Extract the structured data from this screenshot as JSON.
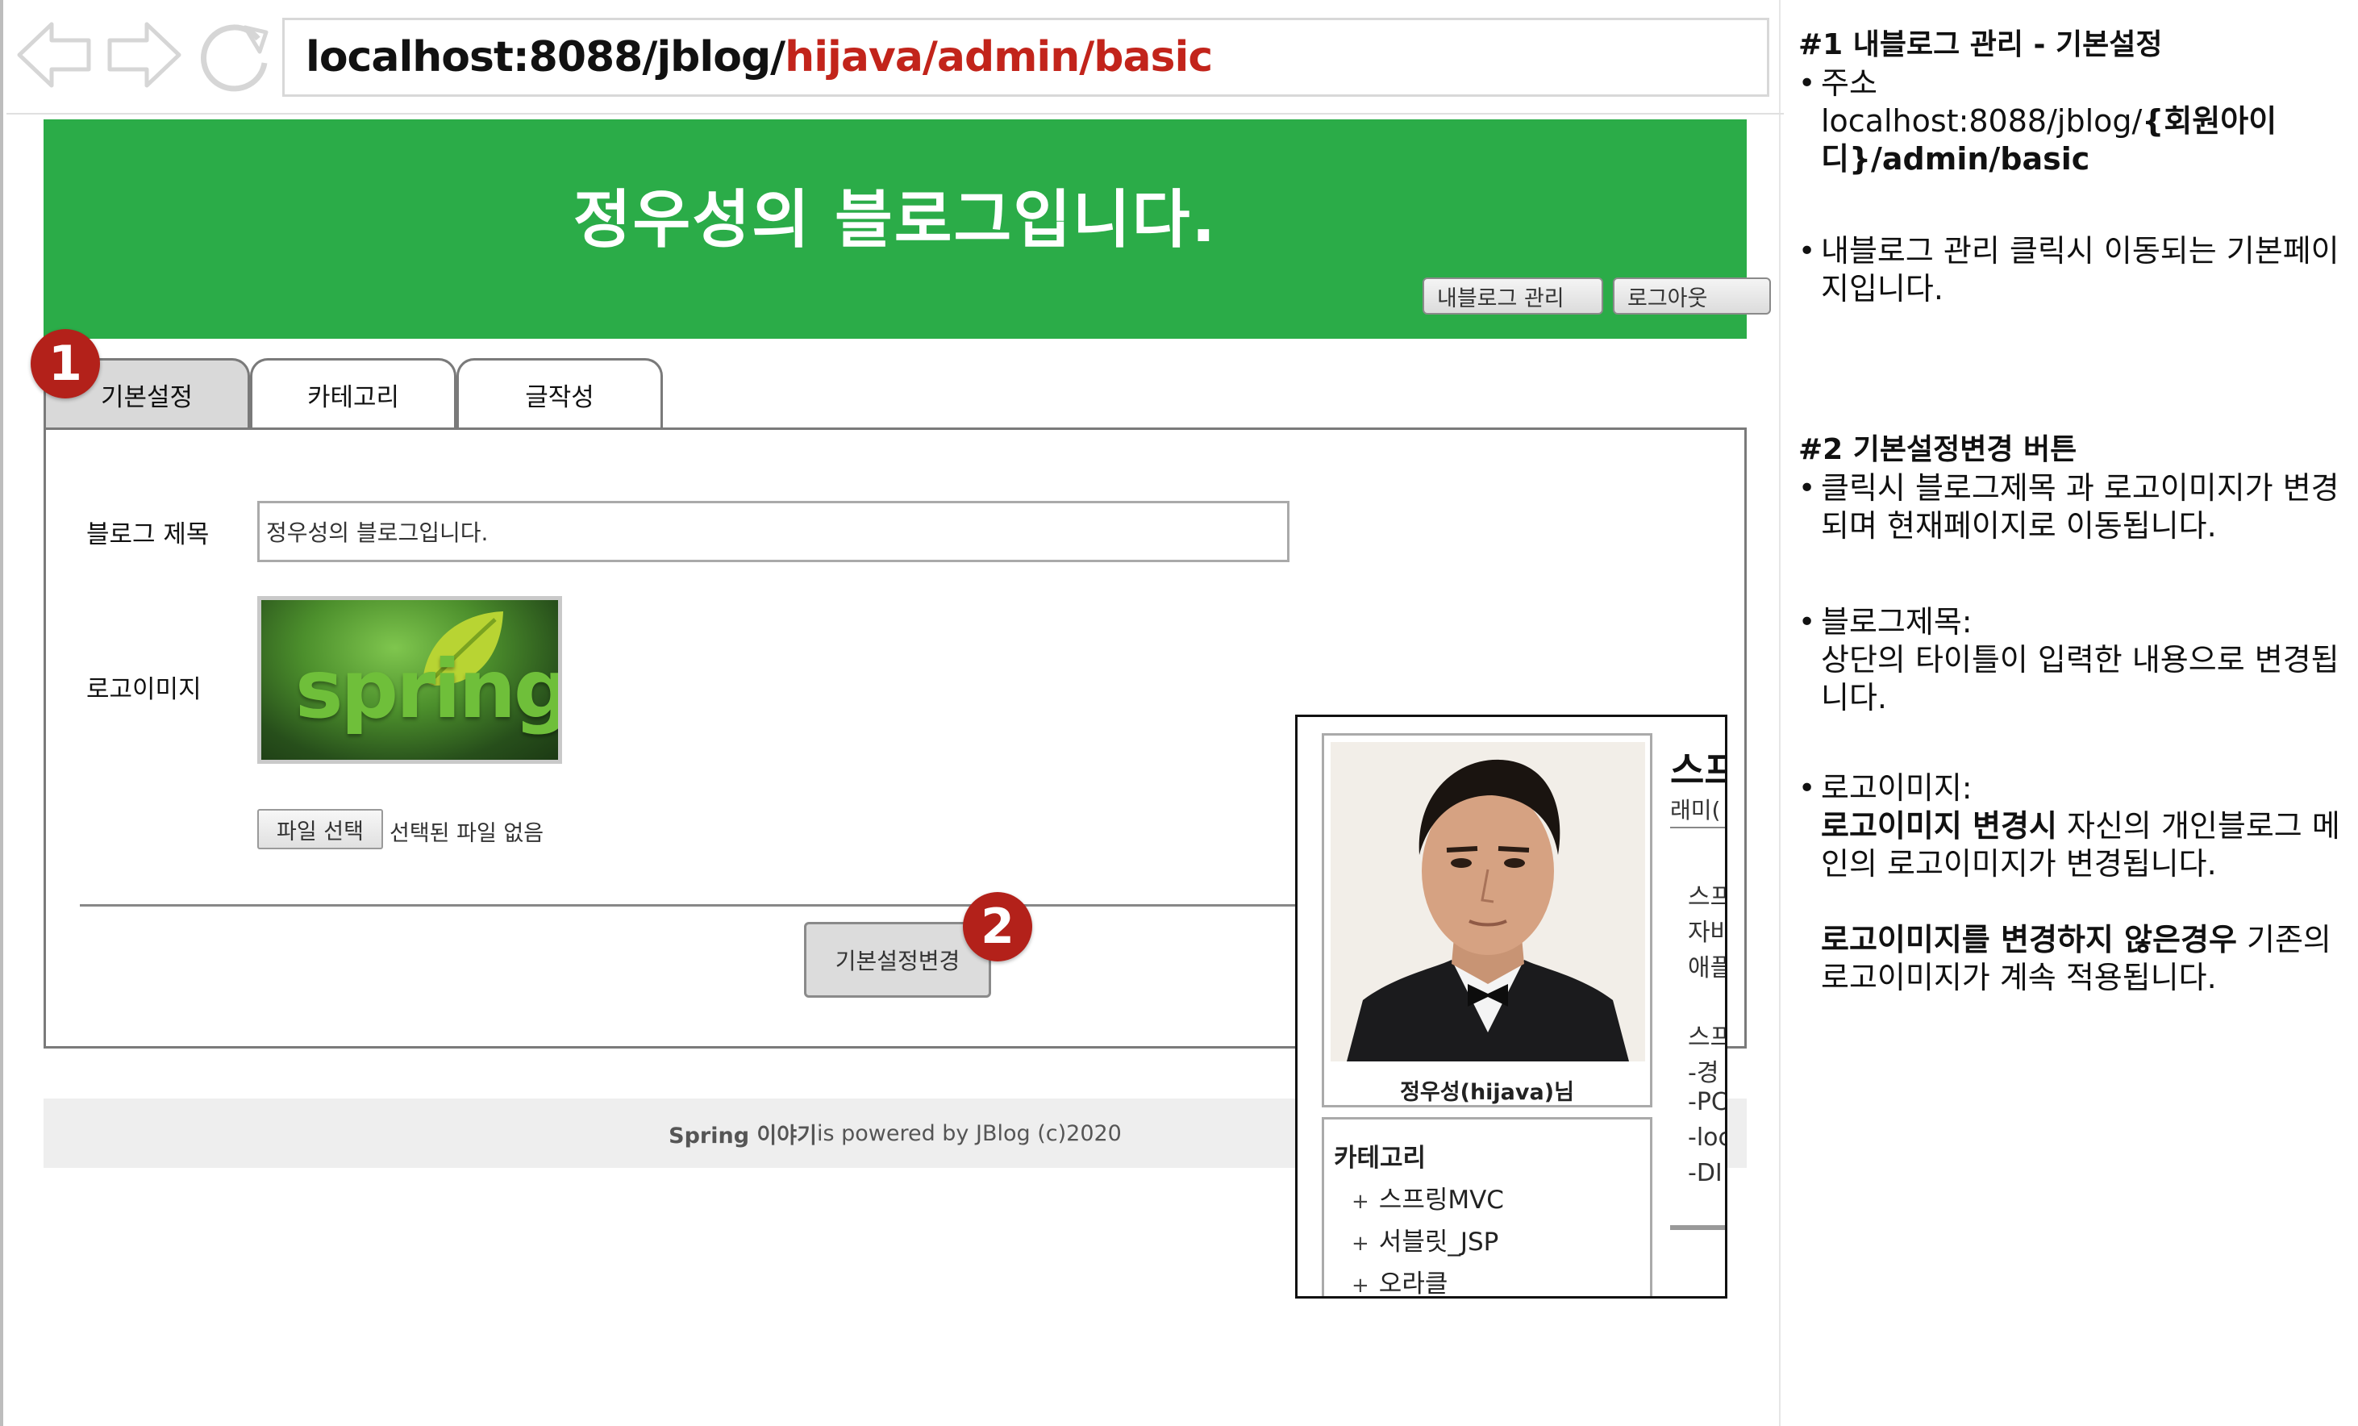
{
  "browser": {
    "url_host": "localhost:8088/jblog/",
    "url_path": "hijava/admin/basic"
  },
  "header": {
    "blog_title": "정우성의 블로그입니다.",
    "myblog_button": "내블로그 관리",
    "logout_button": "로그아웃"
  },
  "tabs": [
    {
      "label": "기본설정",
      "active": true
    },
    {
      "label": "카테고리",
      "active": false
    },
    {
      "label": "글작성",
      "active": false
    }
  ],
  "form": {
    "title_label": "블로그 제목",
    "title_value": "정우성의 블로그입니다.",
    "logo_label": "로고이미지",
    "logo_text": "spring",
    "file_button": "파일 선택",
    "file_status": "선택된 파일 없음",
    "submit_button": "기본설정변경"
  },
  "footer": {
    "brand": "Spring 이야기",
    "rest": " is powered by JBlog (c)2020"
  },
  "markers": {
    "one": "1",
    "two": "2"
  },
  "preview": {
    "profile_name": "정우성(hijava)님",
    "category_title": "카테고리",
    "categories": [
      "스프링MVC",
      "서블릿_JSP",
      "오라클"
    ],
    "post_title": "스프",
    "post_sub": "래미(",
    "post_lines": [
      "스프",
      "자바",
      "애플",
      "스프",
      "-경",
      "-PC",
      "-loc",
      "-DI"
    ]
  },
  "annotations": {
    "h1": "#1 내블로그 관리 - 기본설정",
    "addr_label": "주소",
    "addr_plain": "localhost:8088/jblog/",
    "addr_bold": "{회원아이디}/admin/basic",
    "desc1": "내블로그 관리 클릭시 이동되는 기본페이지입니다.",
    "h2": "#2 기본설정변경 버튼",
    "desc2": "클릭시 블로그제목 과 로고이미지가 변경되며 현재페이지로 이동됩니다.",
    "desc3_label": "블로그제목:",
    "desc3_text": "상단의 타이틀이 입력한 내용으로 변경됩니다.",
    "desc4_label": "로고이미지:",
    "desc4_bold": "로고이미지 변경시",
    "desc4_text": " 자신의 개인블로그 메인의 로고이미지가 변경됩니다.",
    "desc5_bold": "로고이미지를 변경하지 않은경우",
    "desc5_text": " 기존의 로고이미지가 계속 적용됩니다."
  },
  "colors": {
    "header_green": "#2bac48",
    "marker_red": "#b3211a",
    "url_red": "#c2241b"
  }
}
